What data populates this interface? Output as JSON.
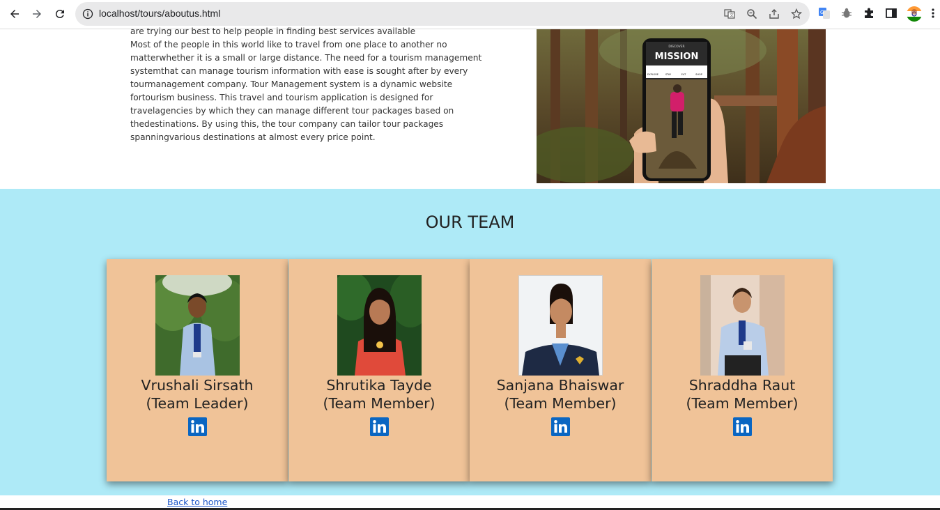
{
  "browser": {
    "url": "localhost/tours/aboutus.html"
  },
  "about": {
    "line_top": "are trying our best to help people in finding best services available",
    "paragraph": "Most of the people in this world like to travel from one place to another no matterwhether it is a small or large distance. The need for a tourism management systemthat can manage tourism information with ease is sought after by every tourmanagement company. Tour Management system is a dynamic website fortourism business. This travel and tourism application is designed for travelagencies by which they can manage different tour packages based on thedestinations. By using this, the tour company can tailor tour packages spanningvarious destinations at almost every price point."
  },
  "mission_image": {
    "title": "MISSION",
    "top_text": "DISCOVER",
    "tabs": [
      "EXPLORE",
      "STAY",
      "EAT",
      "SHOP"
    ]
  },
  "team": {
    "title": "OUR TEAM",
    "members": [
      {
        "name": "Vrushali Sirsath",
        "role": "(Team Leader)"
      },
      {
        "name": "Shrutika Tayde",
        "role": "(Team Member)"
      },
      {
        "name": "Sanjana Bhaiswar",
        "role": "(Team Member)"
      },
      {
        "name": "Shraddha Raut",
        "role": "(Team Member)"
      }
    ]
  },
  "footer": {
    "back_link": "Back to home"
  },
  "colors": {
    "team_bg": "#aeeaf7",
    "card_bg": "#f0c398",
    "linkedin": "#0a66c2",
    "link": "#1a55c9"
  },
  "icons": [
    "back-arrow-icon",
    "forward-arrow-icon",
    "reload-icon",
    "info-icon",
    "translate-icon",
    "zoom-icon",
    "share-icon",
    "star-icon",
    "google-translate-icon",
    "bug-icon",
    "extensions-icon",
    "sidebar-icon",
    "profile-avatar",
    "menu-icon",
    "linkedin-icon"
  ]
}
